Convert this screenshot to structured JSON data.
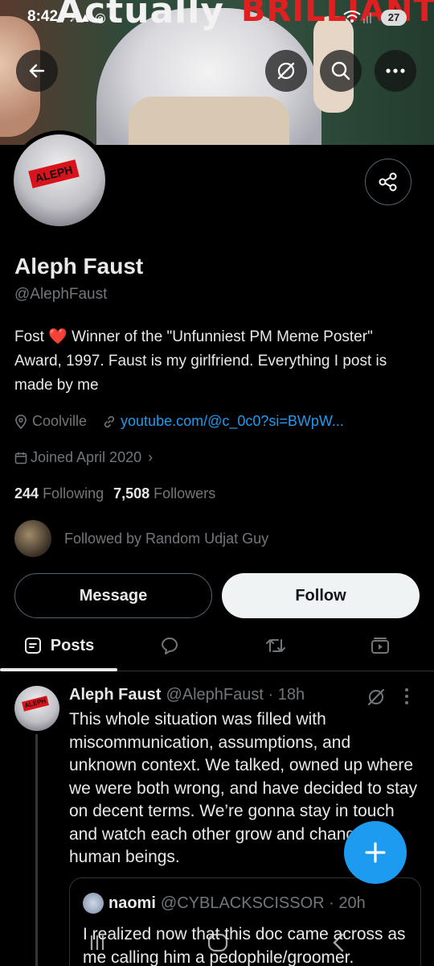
{
  "status_bar": {
    "time": "8:42",
    "battery": "27"
  },
  "banner": {
    "text_white": "Actually",
    "text_red": "BRILLIANT"
  },
  "profile": {
    "avatar_tag": "ALEPH",
    "display_name": "Aleph Faust",
    "handle": "@AlephFaust",
    "bio_before_heart": "Fost ",
    "bio_heart": "❤️",
    "bio_after_heart": " Winner of the \"Unfunniest PM Meme Poster\" Award, 1997. Faust is my girlfriend. Everything I post is made by me",
    "location": "Coolville",
    "link": "youtube.com/@c_0c0?si=BWpW...",
    "joined": "Joined April 2020",
    "following_count": "244",
    "following_label": "Following",
    "followers_count": "7,508",
    "followers_label": "Followers",
    "followed_by": "Followed by Random Udjat Guy"
  },
  "actions": {
    "message": "Message",
    "follow": "Follow"
  },
  "tabs": {
    "posts": "Posts"
  },
  "post": {
    "name": "Aleph Faust",
    "handle_time": "@AlephFaust · 18h",
    "text": "This whole situation was filled with miscommunication, assumptions, and unknown context. We talked, owned up where we were both wrong, and have decided to stay on decent terms. We’re gonna stay in touch and watch each other grow and change like human beings.",
    "quote": {
      "name": "naomi",
      "handle_time": "@CYBLACKSCISSOR · 20h",
      "text": "I realized now that this doc came across as me calling him a pedophile/groomer."
    }
  },
  "colors": {
    "accent": "#1d9bf0",
    "background": "#000000",
    "muted": "#71767b"
  }
}
